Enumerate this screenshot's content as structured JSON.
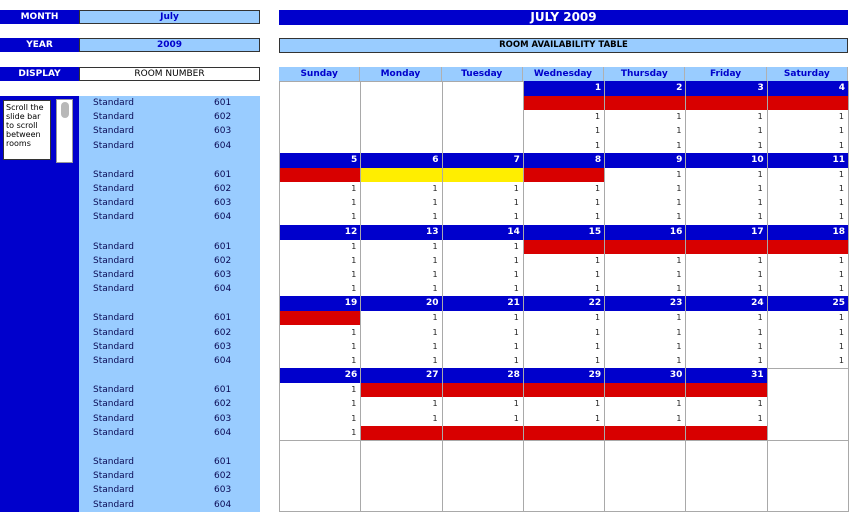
{
  "controls": {
    "month": {
      "label": "MONTH",
      "value": "July"
    },
    "year": {
      "label": "YEAR",
      "value": "2009"
    },
    "display": {
      "label": "DISPLAY",
      "value": "ROOM NUMBER"
    }
  },
  "note": "Scroll the slide bar to scroll between rooms",
  "rooms": [
    {
      "type": "Standard",
      "number": "601"
    },
    {
      "type": "Standard",
      "number": "602"
    },
    {
      "type": "Standard",
      "number": "603"
    },
    {
      "type": "Standard",
      "number": "604"
    }
  ],
  "calendar": {
    "title": "JULY 2009",
    "subtitle": "ROOM AVAILABILITY TABLE",
    "days": [
      "Sunday",
      "Monday",
      "Tuesday",
      "Wednesday",
      "Thursday",
      "Friday",
      "Saturday"
    ],
    "first_weekday": 3,
    "days_in_month": 31,
    "status_colors": {
      "booked": "#d80000",
      "pending": "#ffee00",
      "header": "#0000cc",
      "light": "#99ccff"
    },
    "availability": {
      "1": [
        "B",
        "1",
        "1",
        "1"
      ],
      "2": [
        "B",
        "1",
        "1",
        "1"
      ],
      "3": [
        "B",
        "1",
        "1",
        "1"
      ],
      "4": [
        "B",
        "1",
        "1",
        "1"
      ],
      "5": [
        "B",
        "1",
        "1",
        "1"
      ],
      "6": [
        "P",
        "1",
        "1",
        "1"
      ],
      "7": [
        "P",
        "1",
        "1",
        "1"
      ],
      "8": [
        "B",
        "1",
        "1",
        "1"
      ],
      "9": [
        "1",
        "1",
        "1",
        "1"
      ],
      "10": [
        "1",
        "1",
        "1",
        "1"
      ],
      "11": [
        "1",
        "1",
        "1",
        "1"
      ],
      "12": [
        "1",
        "1",
        "1",
        "1"
      ],
      "13": [
        "1",
        "1",
        "1",
        "1"
      ],
      "14": [
        "1",
        "1",
        "1",
        "1"
      ],
      "15": [
        "B",
        "1",
        "1",
        "1"
      ],
      "16": [
        "B",
        "1",
        "1",
        "1"
      ],
      "17": [
        "B",
        "1",
        "1",
        "1"
      ],
      "18": [
        "B",
        "1",
        "1",
        "1"
      ],
      "19": [
        "B",
        "1",
        "1",
        "1"
      ],
      "20": [
        "1",
        "1",
        "1",
        "1"
      ],
      "21": [
        "1",
        "1",
        "1",
        "1"
      ],
      "22": [
        "1",
        "1",
        "1",
        "1"
      ],
      "23": [
        "1",
        "1",
        "1",
        "1"
      ],
      "24": [
        "1",
        "1",
        "1",
        "1"
      ],
      "25": [
        "1",
        "1",
        "1",
        "1"
      ],
      "26": [
        "1",
        "1",
        "1",
        "1"
      ],
      "27": [
        "B",
        "1",
        "1",
        "B"
      ],
      "28": [
        "B",
        "1",
        "1",
        "B"
      ],
      "29": [
        "B",
        "1",
        "1",
        "B"
      ],
      "30": [
        "B",
        "1",
        "1",
        "B"
      ],
      "31": [
        "B",
        "1",
        "1",
        "B"
      ]
    }
  }
}
